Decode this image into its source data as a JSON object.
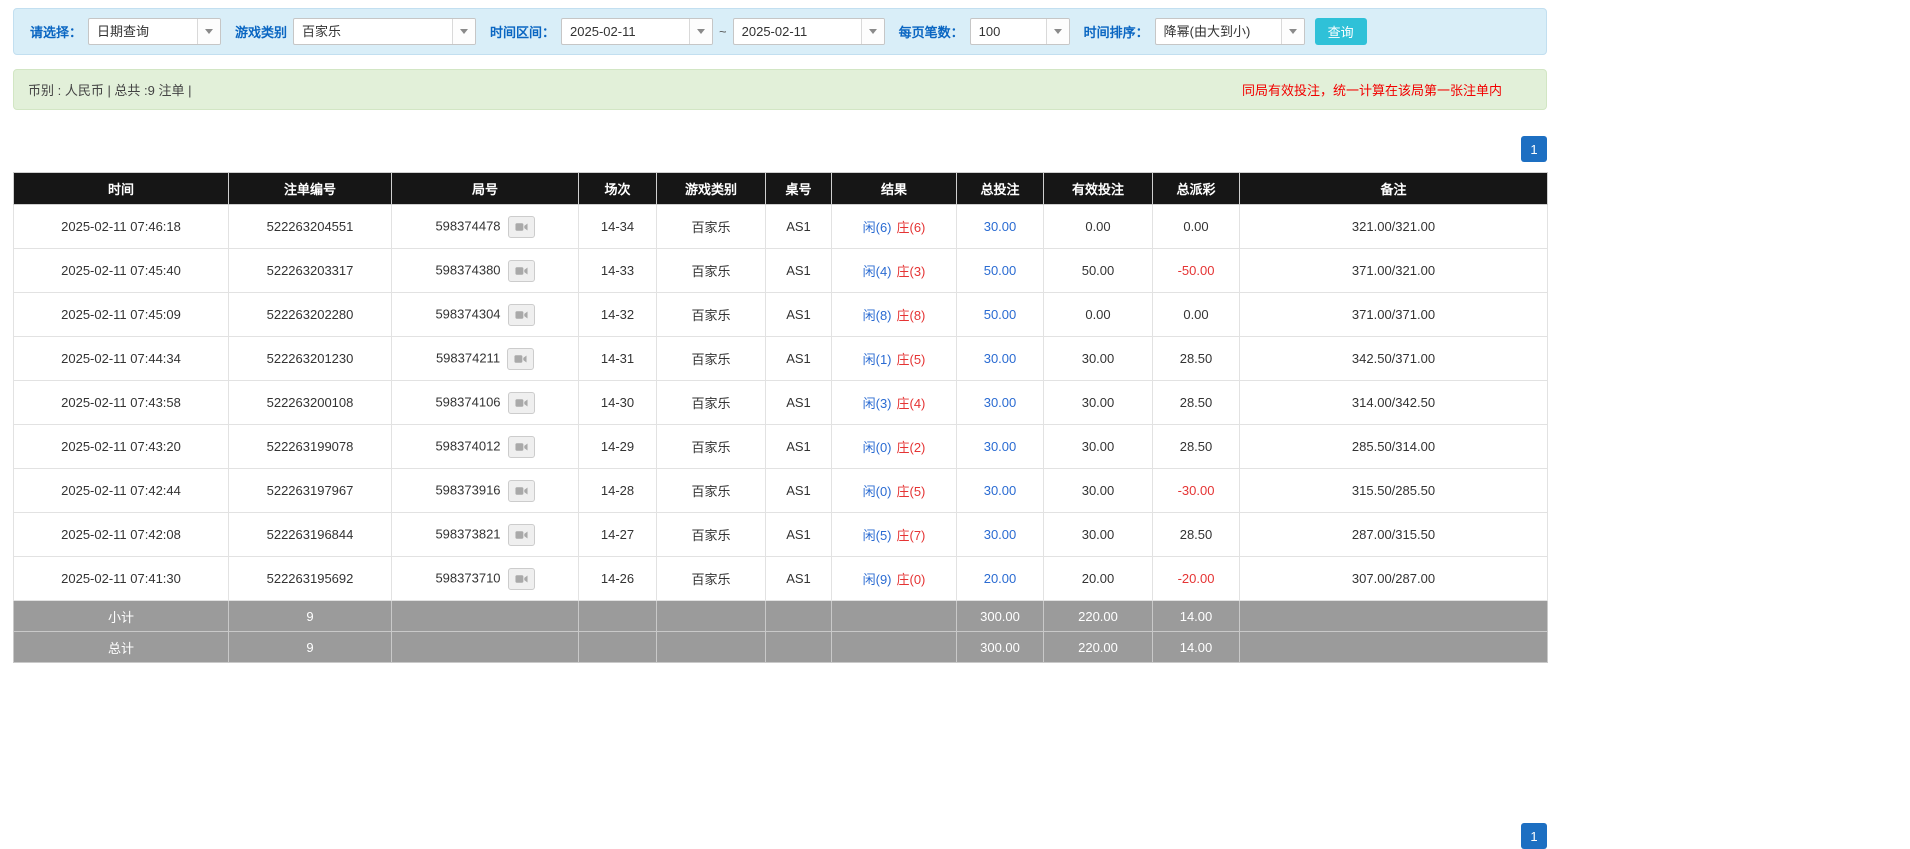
{
  "filter": {
    "select_label": "请选择：",
    "select_value": "日期查询",
    "game_label": "游戏类别",
    "game_value": "百家乐",
    "range_label": "时间区间：",
    "date_from": "2025-02-11",
    "range_separator": "~",
    "date_to": "2025-02-11",
    "per_page_label": "每页笔数：",
    "per_page_value": "100",
    "sort_label": "时间排序：",
    "sort_value": "降幂(由大到小)",
    "query_button": "查询"
  },
  "info_bar": {
    "summary": "币别 : 人民币 | 总共 :9 注单 |",
    "notice": "同局有效投注，统一计算在该局第一张注单内"
  },
  "pagination": {
    "page": "1"
  },
  "icons": {
    "combo_arrow": "chevron-down",
    "round_action": "video-replay-camera"
  },
  "colors": {
    "accent_blue": "#1d6fc2",
    "query_cyan": "#2fc1d8",
    "link_blue": "#2a6bd2",
    "alert_red": "#f20000",
    "negative_red": "#e53434",
    "header_black": "#161616",
    "summary_gray": "#9b9b9b",
    "filter_bg": "#d9eef8",
    "info_bg": "#e2f0d9"
  },
  "table": {
    "headers": [
      "时间",
      "注单编号",
      "局号",
      "场次",
      "游戏类别",
      "桌号",
      "结果",
      "总投注",
      "有效投注",
      "总派彩",
      "备注"
    ],
    "rows": [
      {
        "time": "2025-02-11 07:46:18",
        "bet_no": "522263204551",
        "round_no": "598374478",
        "session": "14-34",
        "game": "百家乐",
        "table_no": "AS1",
        "player": "闲(6)",
        "banker": "庄(6)",
        "total_bet": "30.00",
        "valid_bet": "0.00",
        "payout": "0.00",
        "remark": "321.00/321.00"
      },
      {
        "time": "2025-02-11 07:45:40",
        "bet_no": "522263203317",
        "round_no": "598374380",
        "session": "14-33",
        "game": "百家乐",
        "table_no": "AS1",
        "player": "闲(4)",
        "banker": "庄(3)",
        "total_bet": "50.00",
        "valid_bet": "50.00",
        "payout": "-50.00",
        "remark": "371.00/321.00"
      },
      {
        "time": "2025-02-11 07:45:09",
        "bet_no": "522263202280",
        "round_no": "598374304",
        "session": "14-32",
        "game": "百家乐",
        "table_no": "AS1",
        "player": "闲(8)",
        "banker": "庄(8)",
        "total_bet": "50.00",
        "valid_bet": "0.00",
        "payout": "0.00",
        "remark": "371.00/371.00"
      },
      {
        "time": "2025-02-11 07:44:34",
        "bet_no": "522263201230",
        "round_no": "598374211",
        "session": "14-31",
        "game": "百家乐",
        "table_no": "AS1",
        "player": "闲(1)",
        "banker": "庄(5)",
        "total_bet": "30.00",
        "valid_bet": "30.00",
        "payout": "28.50",
        "remark": "342.50/371.00"
      },
      {
        "time": "2025-02-11 07:43:58",
        "bet_no": "522263200108",
        "round_no": "598374106",
        "session": "14-30",
        "game": "百家乐",
        "table_no": "AS1",
        "player": "闲(3)",
        "banker": "庄(4)",
        "total_bet": "30.00",
        "valid_bet": "30.00",
        "payout": "28.50",
        "remark": "314.00/342.50"
      },
      {
        "time": "2025-02-11 07:43:20",
        "bet_no": "522263199078",
        "round_no": "598374012",
        "session": "14-29",
        "game": "百家乐",
        "table_no": "AS1",
        "player": "闲(0)",
        "banker": "庄(2)",
        "total_bet": "30.00",
        "valid_bet": "30.00",
        "payout": "28.50",
        "remark": "285.50/314.00"
      },
      {
        "time": "2025-02-11 07:42:44",
        "bet_no": "522263197967",
        "round_no": "598373916",
        "session": "14-28",
        "game": "百家乐",
        "table_no": "AS1",
        "player": "闲(0)",
        "banker": "庄(5)",
        "total_bet": "30.00",
        "valid_bet": "30.00",
        "payout": "-30.00",
        "remark": "315.50/285.50"
      },
      {
        "time": "2025-02-11 07:42:08",
        "bet_no": "522263196844",
        "round_no": "598373821",
        "session": "14-27",
        "game": "百家乐",
        "table_no": "AS1",
        "player": "闲(5)",
        "banker": "庄(7)",
        "total_bet": "30.00",
        "valid_bet": "30.00",
        "payout": "28.50",
        "remark": "287.00/315.50"
      },
      {
        "time": "2025-02-11 07:41:30",
        "bet_no": "522263195692",
        "round_no": "598373710",
        "session": "14-26",
        "game": "百家乐",
        "table_no": "AS1",
        "player": "闲(9)",
        "banker": "庄(0)",
        "total_bet": "20.00",
        "valid_bet": "20.00",
        "payout": "-20.00",
        "remark": "307.00/287.00"
      }
    ],
    "subtotal": {
      "label": "小计",
      "count": "9",
      "total_bet": "300.00",
      "valid_bet": "220.00",
      "payout": "14.00"
    },
    "total": {
      "label": "总计",
      "count": "9",
      "total_bet": "300.00",
      "valid_bet": "220.00",
      "payout": "14.00"
    }
  }
}
